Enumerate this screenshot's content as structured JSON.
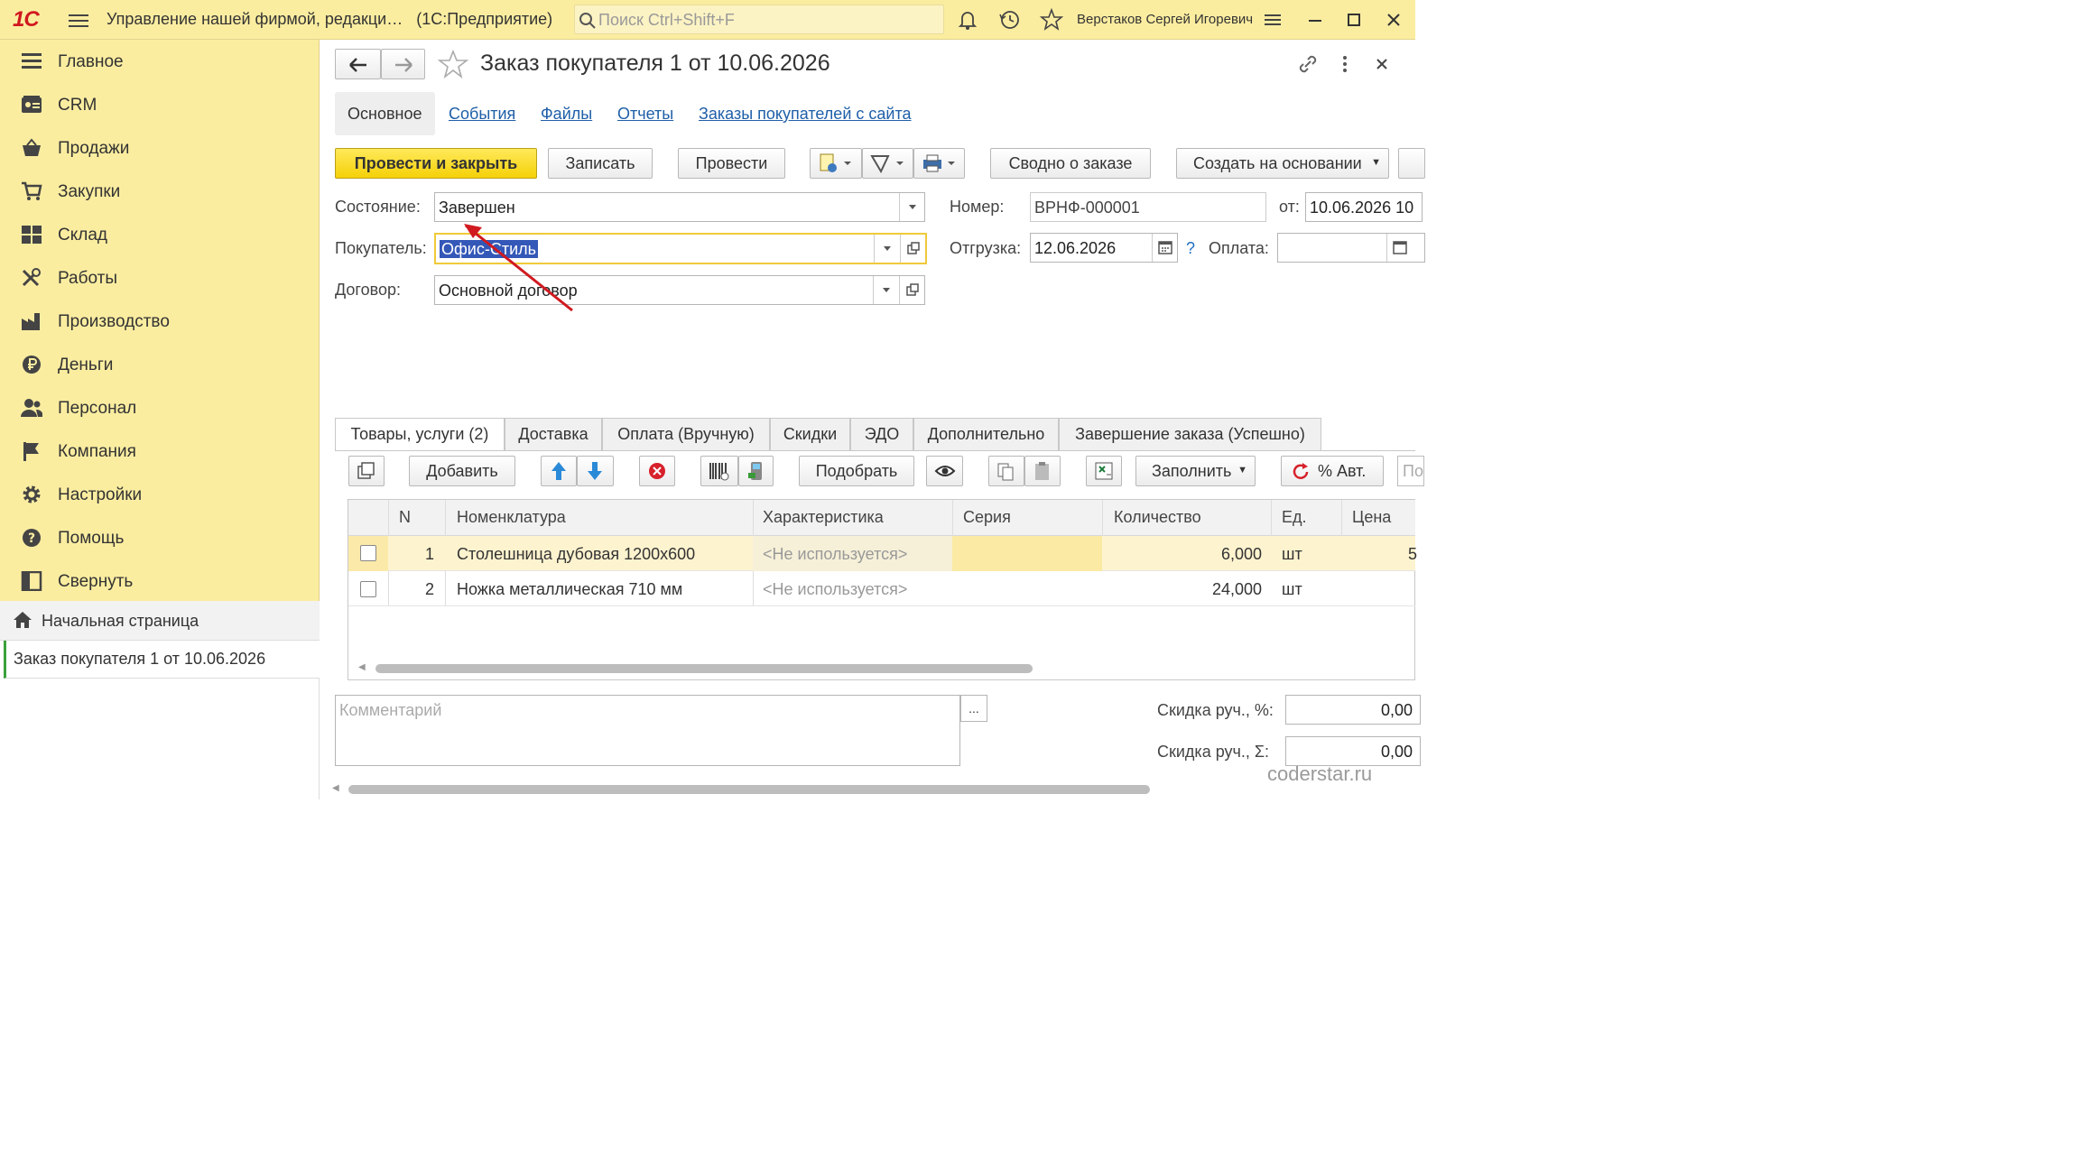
{
  "app": {
    "title": "Управление нашей фирмой, редакци…",
    "platform": "(1С:Предприятие)",
    "logo_text": "1С",
    "search_placeholder": "Поиск Ctrl+Shift+F",
    "user": "Верстаков Сергей Игоревич"
  },
  "sidebar": {
    "items": [
      {
        "label": "Главное",
        "icon": "menu-lines-icon"
      },
      {
        "label": "CRM",
        "icon": "contact-card-icon"
      },
      {
        "label": "Продажи",
        "icon": "basket-icon"
      },
      {
        "label": "Закупки",
        "icon": "cart-icon"
      },
      {
        "label": "Склад",
        "icon": "warehouse-grid-icon"
      },
      {
        "label": "Работы",
        "icon": "tools-icon"
      },
      {
        "label": "Производство",
        "icon": "factory-icon"
      },
      {
        "label": "Деньги",
        "icon": "ruble-icon"
      },
      {
        "label": "Персонал",
        "icon": "people-icon"
      },
      {
        "label": "Компания",
        "icon": "flag-icon"
      },
      {
        "label": "Настройки",
        "icon": "gear-icon"
      },
      {
        "label": "Помощь",
        "icon": "help-icon"
      },
      {
        "label": "Свернуть",
        "icon": "collapse-panel-icon"
      }
    ],
    "open_windows": {
      "home": "Начальная страница",
      "current": "Заказ покупателя 1 от 10.06.2026"
    }
  },
  "document": {
    "title": "Заказ покупателя 1 от 10.06.2026",
    "nav_tabs": [
      "Основное",
      "События",
      "Файлы",
      "Отчеты",
      "Заказы покупателей с сайта"
    ],
    "commands": {
      "post_close": "Провести и закрыть",
      "save": "Записать",
      "post": "Провести",
      "summary": "Сводно о заказе",
      "create_based": "Создать на основании"
    },
    "fields": {
      "state_label": "Состояние:",
      "state_value": "Завершен",
      "customer_label": "Покупатель:",
      "customer_value": "Офис-Стиль",
      "contract_label": "Договор:",
      "contract_value": "Основной договор",
      "number_label": "Номер:",
      "number_value": "ВРНФ-000001",
      "date_label": "от:",
      "date_value": "10.06.2026 10",
      "shipment_label": "Отгрузка:",
      "shipment_value": "12.06.2026",
      "help_mark": "?",
      "payment_label": "Оплата:",
      "payment_value": "  .  ."
    },
    "tabs": [
      "Товары, услуги (2)",
      "Доставка",
      "Оплата (Вручную)",
      "Скидки",
      "ЭДО",
      "Дополнительно",
      "Завершение заказа (Успешно)"
    ],
    "table_toolbar": {
      "add": "Добавить",
      "pick": "Подобрать",
      "fill": "Заполнить",
      "auto_percent": "% Авт.",
      "search_stub": "По"
    },
    "table": {
      "columns": [
        "N",
        "Номенклатура",
        "Характеристика",
        "Серия",
        "Количество",
        "Ед.",
        "Цена"
      ],
      "rows": [
        {
          "n": "1",
          "item": "Столешница дубовая 1200х600",
          "characteristic": "<Не используется>",
          "series": "",
          "qty": "6,000",
          "unit": "шт",
          "price": "5"
        },
        {
          "n": "2",
          "item": "Ножка металлическая 710 мм",
          "characteristic": "<Не используется>",
          "series": "",
          "qty": "24,000",
          "unit": "шт",
          "price": ""
        }
      ]
    },
    "footer": {
      "comment_placeholder": "Комментарий",
      "ellipsis": "...",
      "discount_pct_label": "Скидка руч., %:",
      "discount_pct_value": "0,00",
      "discount_sum_label": "Скидка руч., Σ:",
      "discount_sum_value": "0,00"
    },
    "watermark": "coderstar.ru"
  },
  "colors": {
    "topbar": "#fbeda0",
    "primary_button": "#f5d108",
    "link": "#1f5fa8",
    "selected_row": "#fdf3cf",
    "arrow": "#d01a20"
  }
}
